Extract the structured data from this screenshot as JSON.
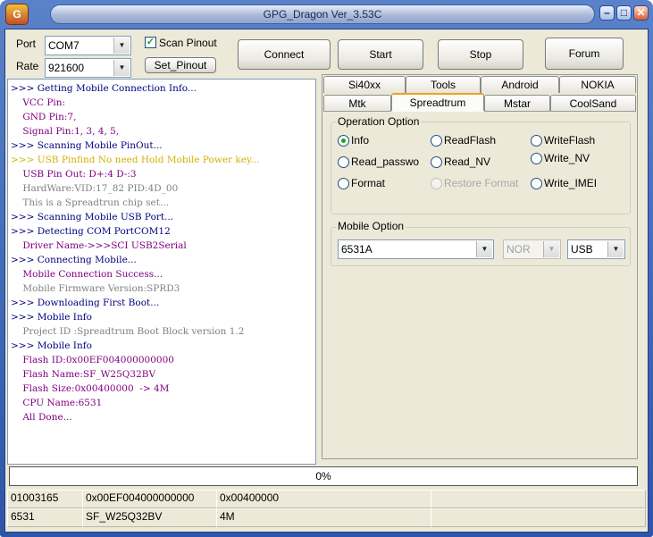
{
  "window": {
    "title": "GPG_Dragon  Ver_3.53C",
    "icon_text": "G",
    "min": "–",
    "max": "□",
    "close": "✕"
  },
  "connection": {
    "port_label": "Port",
    "port_value": "COM7",
    "rate_label": "Rate",
    "rate_value": "921600",
    "scan_pinout_label": "Scan Pinout",
    "scan_pinout_checked": true,
    "set_pinout_label": "Set_Pinout"
  },
  "toolbar": {
    "connect": "Connect",
    "start": "Start",
    "stop": "Stop",
    "forum": "Forum"
  },
  "log": [
    {
      "text": ">>> Getting Mobile Connection Info...",
      "color": "navy"
    },
    {
      "text": "    VCC Pin:",
      "color": "purple"
    },
    {
      "text": "    GND Pin:7,",
      "color": "purple"
    },
    {
      "text": "    Signal Pin:1, 3, 4, 5,",
      "color": "purple"
    },
    {
      "text": ">>> Scanning Mobile PinOut...",
      "color": "navy"
    },
    {
      "text": ">>> USB Pinfind No need Hold Mobile Power key...",
      "color": "yellow"
    },
    {
      "text": "    USB Pin Out: D+:4 D-:3",
      "color": "purple"
    },
    {
      "text": "    HardWare:VID:17_82 PID:4D_00",
      "color": "gray"
    },
    {
      "text": "    This is a Spreadtrun chip set...",
      "color": "gray"
    },
    {
      "text": ">>> Scanning Mobile USB Port...",
      "color": "navy"
    },
    {
      "text": ">>> Detecting COM PortCOM12",
      "color": "navy"
    },
    {
      "text": "    Driver Name->>>SCI USB2Serial",
      "color": "purple"
    },
    {
      "text": ">>> Connecting Mobile...",
      "color": "navy"
    },
    {
      "text": "    Mobile Connection Success...",
      "color": "purple"
    },
    {
      "text": "    Mobile Firmware Version:SPRD3",
      "color": "gray"
    },
    {
      "text": ">>> Downloading First Boot...",
      "color": "navy"
    },
    {
      "text": ">>> Mobile Info",
      "color": "navy"
    },
    {
      "text": "    Project ID :Spreadtrum Boot Block version 1.2",
      "color": "gray"
    },
    {
      "text": ">>> Mobile Info",
      "color": "navy"
    },
    {
      "text": "    Flash ID:0x00EF004000000000",
      "color": "purple"
    },
    {
      "text": "    Flash Name:SF_W25Q32BV",
      "color": "purple"
    },
    {
      "text": "    Flash Size:0x00400000  -> 4M",
      "color": "purple"
    },
    {
      "text": "    CPU Name:6531",
      "color": "purple"
    },
    {
      "text": "    All Done...",
      "color": "purple"
    }
  ],
  "tabs_row1": [
    "Si40xx",
    "Tools",
    "Android",
    "NOKIA"
  ],
  "tabs_row2": [
    "Mtk",
    "Spreadtrum",
    "Mstar",
    "CoolSand"
  ],
  "active_tab": "Spreadtrum",
  "operation_option": {
    "title": "Operation Option",
    "info": "Info",
    "read_flash": "ReadFlash",
    "write_flash": "WriteFlash",
    "read_password": "Read_passwo",
    "read_nv": "Read_NV",
    "write_nv": "Write_NV",
    "format": "Format",
    "restore_format": "Restore Format",
    "write_imei": "Write_IMEI",
    "selected": "Info"
  },
  "mobile_option": {
    "title": "Mobile Option",
    "model": "6531A",
    "flash_type": "NOR",
    "interface": "USB"
  },
  "progress": {
    "text": "0%",
    "fraction": 0
  },
  "status_rows": [
    [
      "01003165",
      "0x00EF004000000000",
      "0x00400000",
      ""
    ],
    [
      "6531",
      "SF_W25Q32BV",
      "4M",
      ""
    ]
  ],
  "colors": {
    "navy": "#000080",
    "purple": "#800080",
    "gray": "#808080",
    "yellow": "#d4b000",
    "accent": "#21a121"
  }
}
